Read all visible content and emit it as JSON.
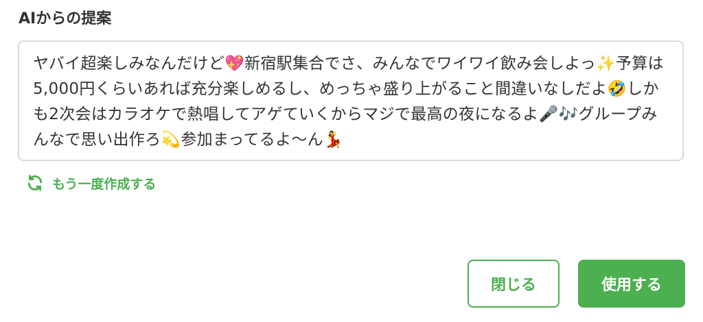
{
  "panel": {
    "title": "AIからの提案"
  },
  "suggestion": {
    "text": "ヤバイ超楽しみなんだけど💖新宿駅集合でさ、みんなでワイワイ飲み会しよっ✨予算は5,000円くらいあれば充分楽しめるし、めっちゃ盛り上がること間違いなしだよ🤣しかも2次会はカラオケで熱唱してアゲていくからマジで最高の夜になるよ🎤🎶グループみんなで思い出作ろ💫参加まってるよ〜ん💃"
  },
  "regenerate": {
    "label": "もう一度作成する",
    "icon": "refresh-icon"
  },
  "buttons": {
    "close_label": "閉じる",
    "use_label": "使用する"
  },
  "colors": {
    "accent": "#4caf50",
    "text": "#333333",
    "border": "#d9d9d9"
  }
}
